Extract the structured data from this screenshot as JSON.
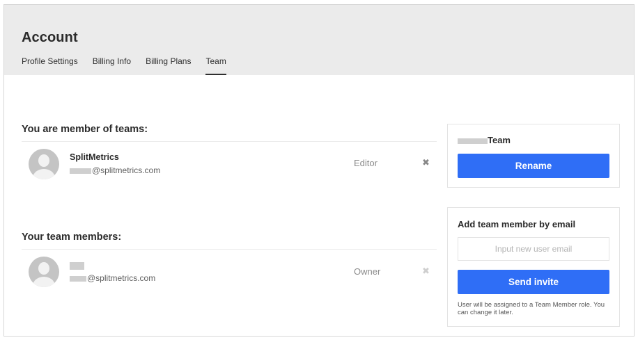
{
  "header": {
    "title": "Account",
    "tabs": [
      {
        "label": "Profile Settings"
      },
      {
        "label": "Billing Info"
      },
      {
        "label": "Billing Plans"
      },
      {
        "label": "Team",
        "active": true
      }
    ]
  },
  "teams_section": {
    "title": "You are member of teams:",
    "members": [
      {
        "name": "SplitMetrics",
        "email_suffix": "@splitmetrics.com",
        "role": "Editor",
        "remove_icon": "close-icon"
      }
    ]
  },
  "members_section": {
    "title": "Your team members:",
    "members": [
      {
        "name": "",
        "email_suffix": "@splitmetrics.com",
        "role": "Owner",
        "remove_icon": "close-icon"
      }
    ]
  },
  "team_card": {
    "title_suffix": "Team",
    "rename_label": "Rename"
  },
  "invite_card": {
    "title": "Add team member by email",
    "email_placeholder": "Input new user email",
    "email_value": "",
    "send_label": "Send invite",
    "hint": "User will be assigned to a Team Member role. You can change it later."
  },
  "colors": {
    "accent": "#2f6ef6",
    "header_bg": "#ebebeb",
    "remove_active": "#888888",
    "remove_disabled": "#cfcfcf"
  }
}
